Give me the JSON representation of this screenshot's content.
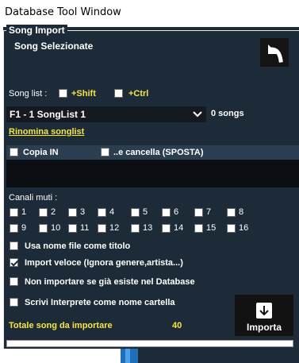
{
  "window": {
    "title": "Database Tool Window"
  },
  "group": {
    "legend": "Song Import"
  },
  "selected_label": "Song Selezionate",
  "back_icon": "undo-arrow-icon",
  "songlist": {
    "label": "Song list :",
    "shift_label": "+Shift",
    "ctrl_label": "+Ctrl",
    "shift_checked": false,
    "ctrl_checked": false,
    "selected": "F1 - 1 SongList 1",
    "count": "0 songs",
    "rename_link": "Rinomina songlist"
  },
  "copy": {
    "copy_in_label": "Copia IN",
    "cancel_label": "..e cancella (SPOSTA)"
  },
  "channels": {
    "label": "Canali muti :",
    "items": [
      "1",
      "2",
      "3",
      "4",
      "5",
      "6",
      "7",
      "8",
      "9",
      "10",
      "11",
      "12",
      "13",
      "14",
      "15",
      "16"
    ]
  },
  "options": {
    "filename_title": "Usa nome file come titolo",
    "fast_import": "Import veloce (Ignora genere,artista...)",
    "skip_existing": "Non importare se già esiste nel Database",
    "write_artist": "Scrivi Interprete come nome cartella",
    "fast_import_checked": true
  },
  "totals": {
    "label": "Totale song da importare",
    "value": "40"
  },
  "import_button": {
    "label": "Importa",
    "icon": "download-arrow-icon"
  },
  "colors": {
    "panel": "#1d2b38",
    "accent": "#f5e642",
    "text": "#ffffff"
  }
}
